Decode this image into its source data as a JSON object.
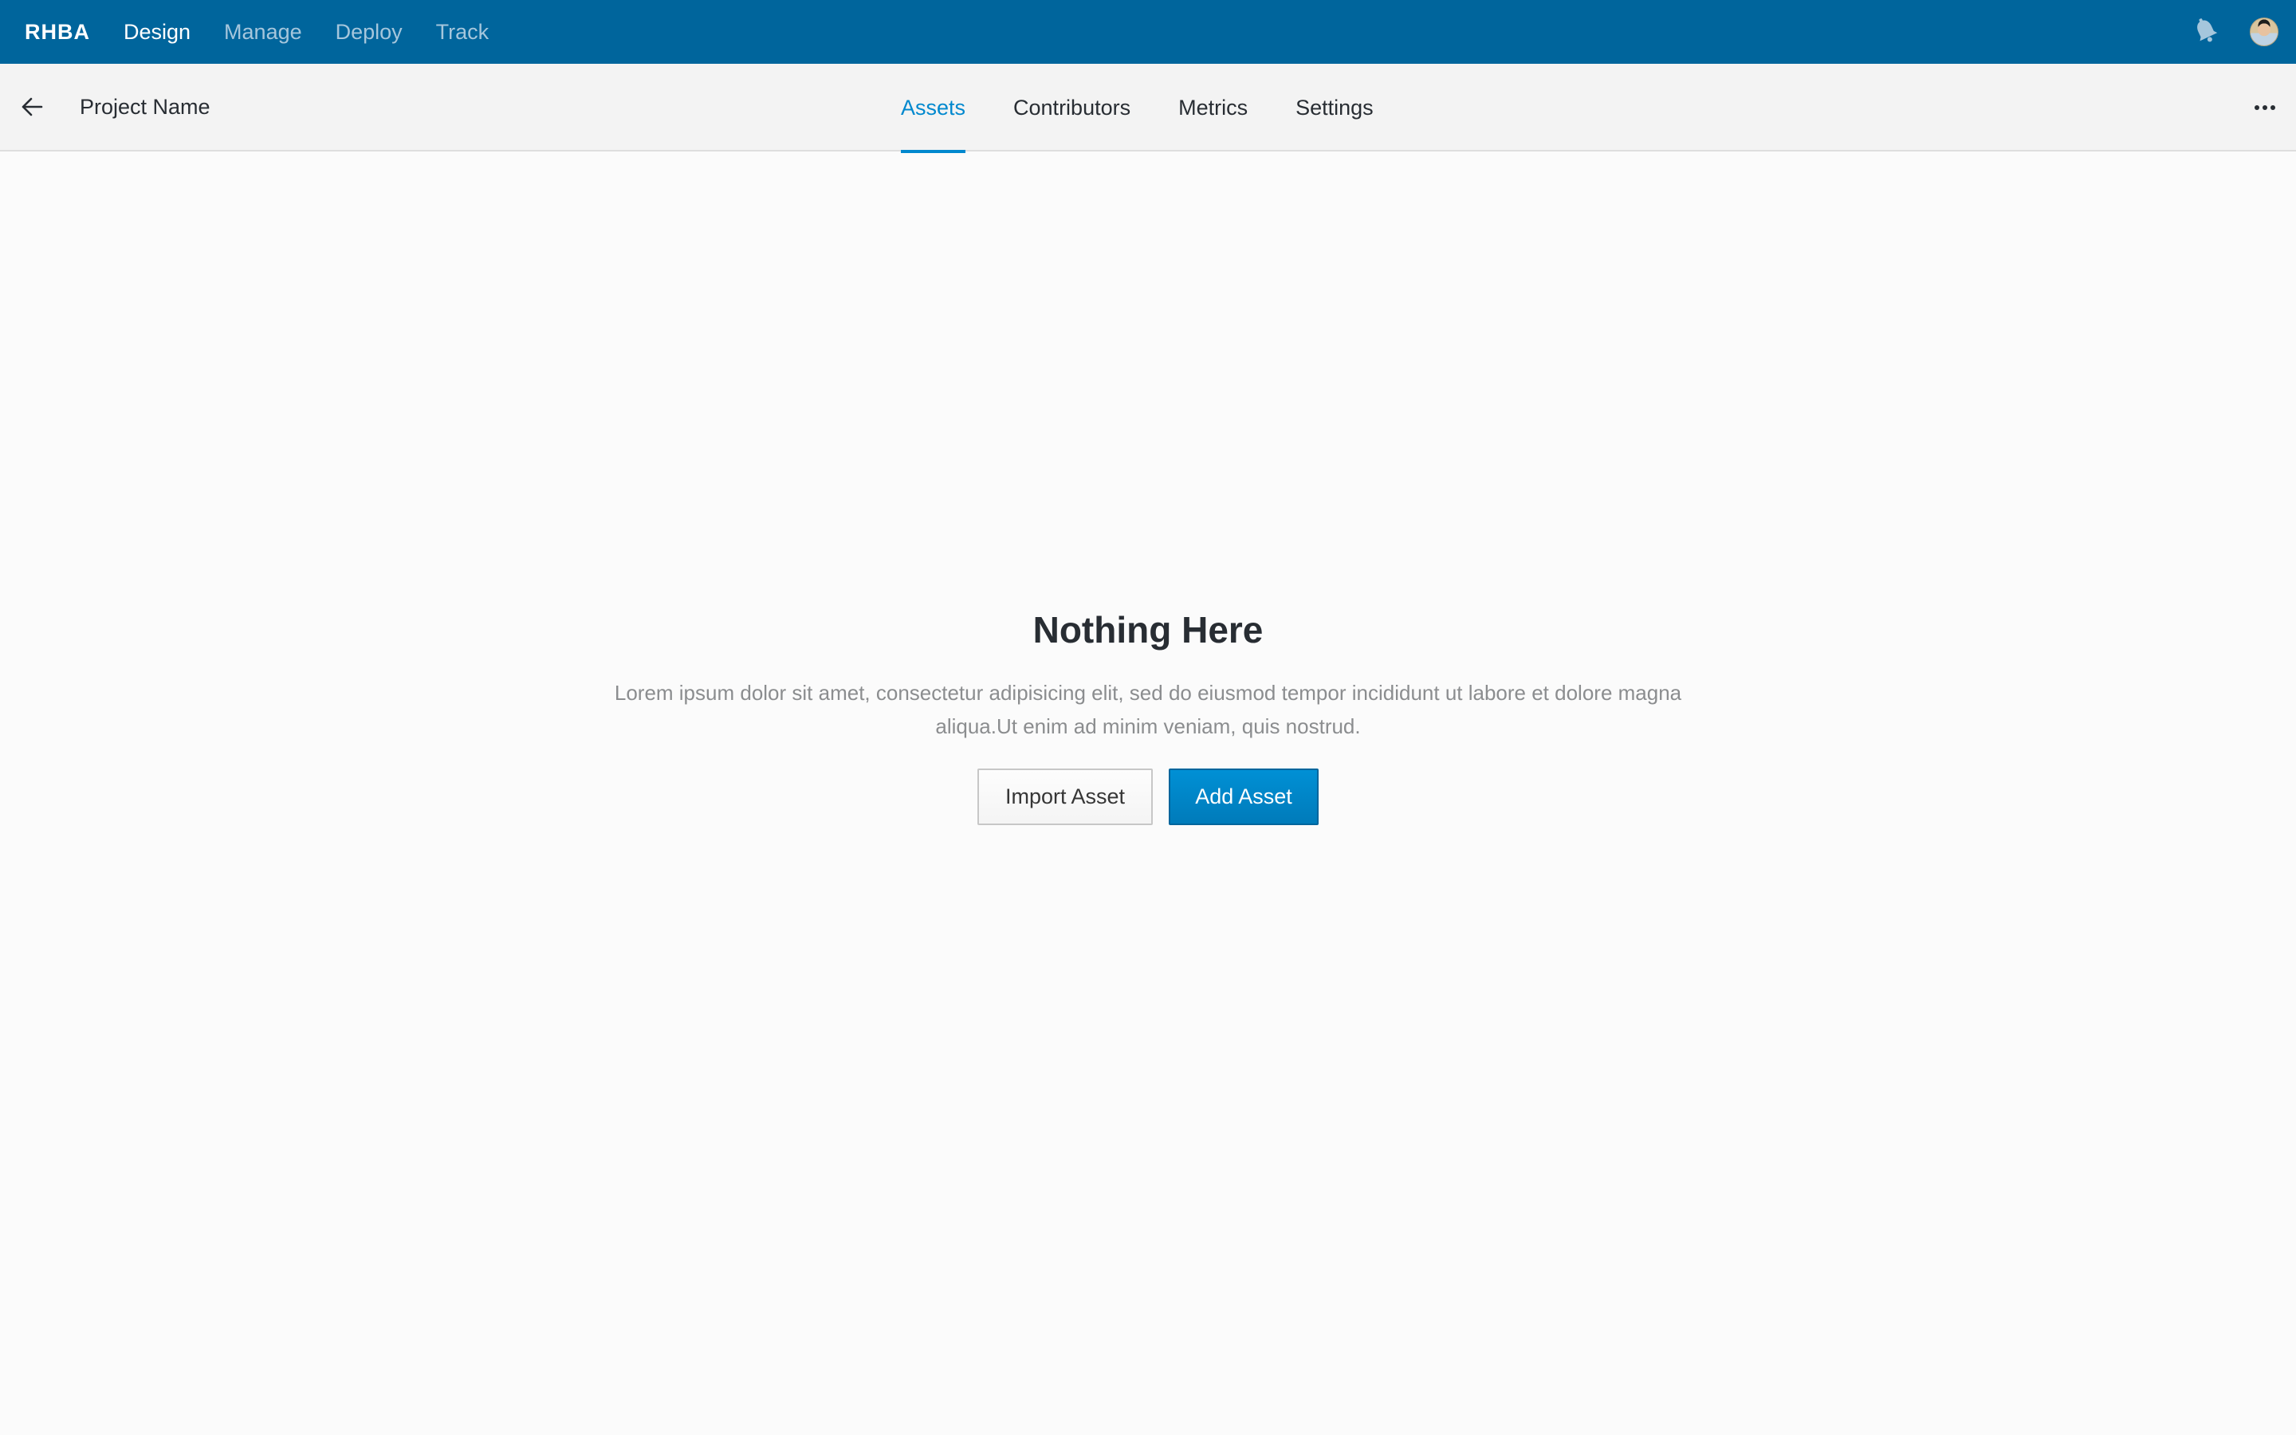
{
  "masthead": {
    "brand": "RHBA",
    "nav": [
      {
        "label": "Design",
        "active": true
      },
      {
        "label": "Manage",
        "active": false
      },
      {
        "label": "Deploy",
        "active": false
      },
      {
        "label": "Track",
        "active": false
      }
    ],
    "icons": {
      "notifications": "bell-icon",
      "user": "avatar"
    }
  },
  "subheader": {
    "back_icon": "arrow-left-icon",
    "project_name": "Project Name",
    "tabs": [
      {
        "label": "Assets",
        "active": true
      },
      {
        "label": "Contributors",
        "active": false
      },
      {
        "label": "Metrics",
        "active": false
      },
      {
        "label": "Settings",
        "active": false
      }
    ],
    "more_icon": "ellipsis-horizontal-icon"
  },
  "empty_state": {
    "title": "Nothing Here",
    "body": "Lorem ipsum dolor sit amet, consectetur adipisicing elit, sed do eiusmod tempor incididunt ut labore et dolore magna aliqua.Ut enim ad minim veniam, quis nostrud.",
    "secondary_action": "Import Asset",
    "primary_action": "Add Asset"
  },
  "colors": {
    "masthead_bg": "#00659c",
    "accent": "#0088ce",
    "subheader_bg": "#f3f3f3",
    "page_bg": "#fbfbfb"
  }
}
